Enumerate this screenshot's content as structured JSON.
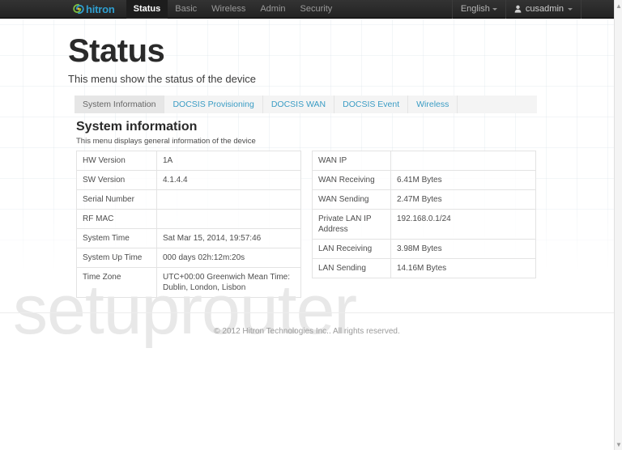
{
  "navbar": {
    "brand": {
      "icon": "hitron-swirl-logo-icon",
      "text": "hitron"
    },
    "menu": [
      {
        "label": "Status",
        "active": true
      },
      {
        "label": "Basic",
        "active": false
      },
      {
        "label": "Wireless",
        "active": false
      },
      {
        "label": "Admin",
        "active": false
      },
      {
        "label": "Security",
        "active": false
      }
    ],
    "language": {
      "label": "English",
      "caret": "chevron-down-icon"
    },
    "user": {
      "icon": "user-icon",
      "label": "cusadmin",
      "caret": "chevron-down-icon"
    }
  },
  "page": {
    "title": "Status",
    "subtitle": "This menu show the status of the device"
  },
  "tabs": [
    {
      "label": "System Information",
      "active": true
    },
    {
      "label": "DOCSIS Provisioning",
      "active": false
    },
    {
      "label": "DOCSIS WAN",
      "active": false
    },
    {
      "label": "DOCSIS Event",
      "active": false
    },
    {
      "label": "Wireless",
      "active": false
    }
  ],
  "section": {
    "title": "System information",
    "subtitle": "This menu displays general information of the device"
  },
  "left_table": [
    {
      "key": "HW Version",
      "value": "1A"
    },
    {
      "key": "SW Version",
      "value": "4.1.4.4"
    },
    {
      "key": "Serial Number",
      "value": ""
    },
    {
      "key": "RF MAC",
      "value": ""
    },
    {
      "key": "System Time",
      "value": "Sat Mar 15, 2014, 19:57:46"
    },
    {
      "key": "System Up Time",
      "value": "000 days 02h:12m:20s"
    },
    {
      "key": "Time Zone",
      "value": "UTC+00:00 Greenwich Mean Time: Dublin, London, Lisbon"
    }
  ],
  "right_table": [
    {
      "key": "WAN IP",
      "value": ""
    },
    {
      "key": "WAN Receiving",
      "value": "6.41M Bytes"
    },
    {
      "key": "WAN Sending",
      "value": "2.47M Bytes"
    },
    {
      "key": "Private LAN IP Address",
      "value": "192.168.0.1/24"
    },
    {
      "key": "LAN Receiving",
      "value": "3.98M Bytes"
    },
    {
      "key": "LAN Sending",
      "value": "14.16M Bytes"
    }
  ],
  "watermark": "setuprouter",
  "footer": {
    "copyright": "© 2012 Hitron Technologies Inc.. All rights reserved."
  },
  "scrollbar": {
    "up": "▲",
    "down": "▼"
  },
  "colors": {
    "navbar_bg": "#2b2b2b",
    "brand_blue": "#2f9fd0",
    "link_blue": "#3a9cc4",
    "tab_active_bg": "#e6e6e6",
    "watermark": "#e8e8e8"
  }
}
